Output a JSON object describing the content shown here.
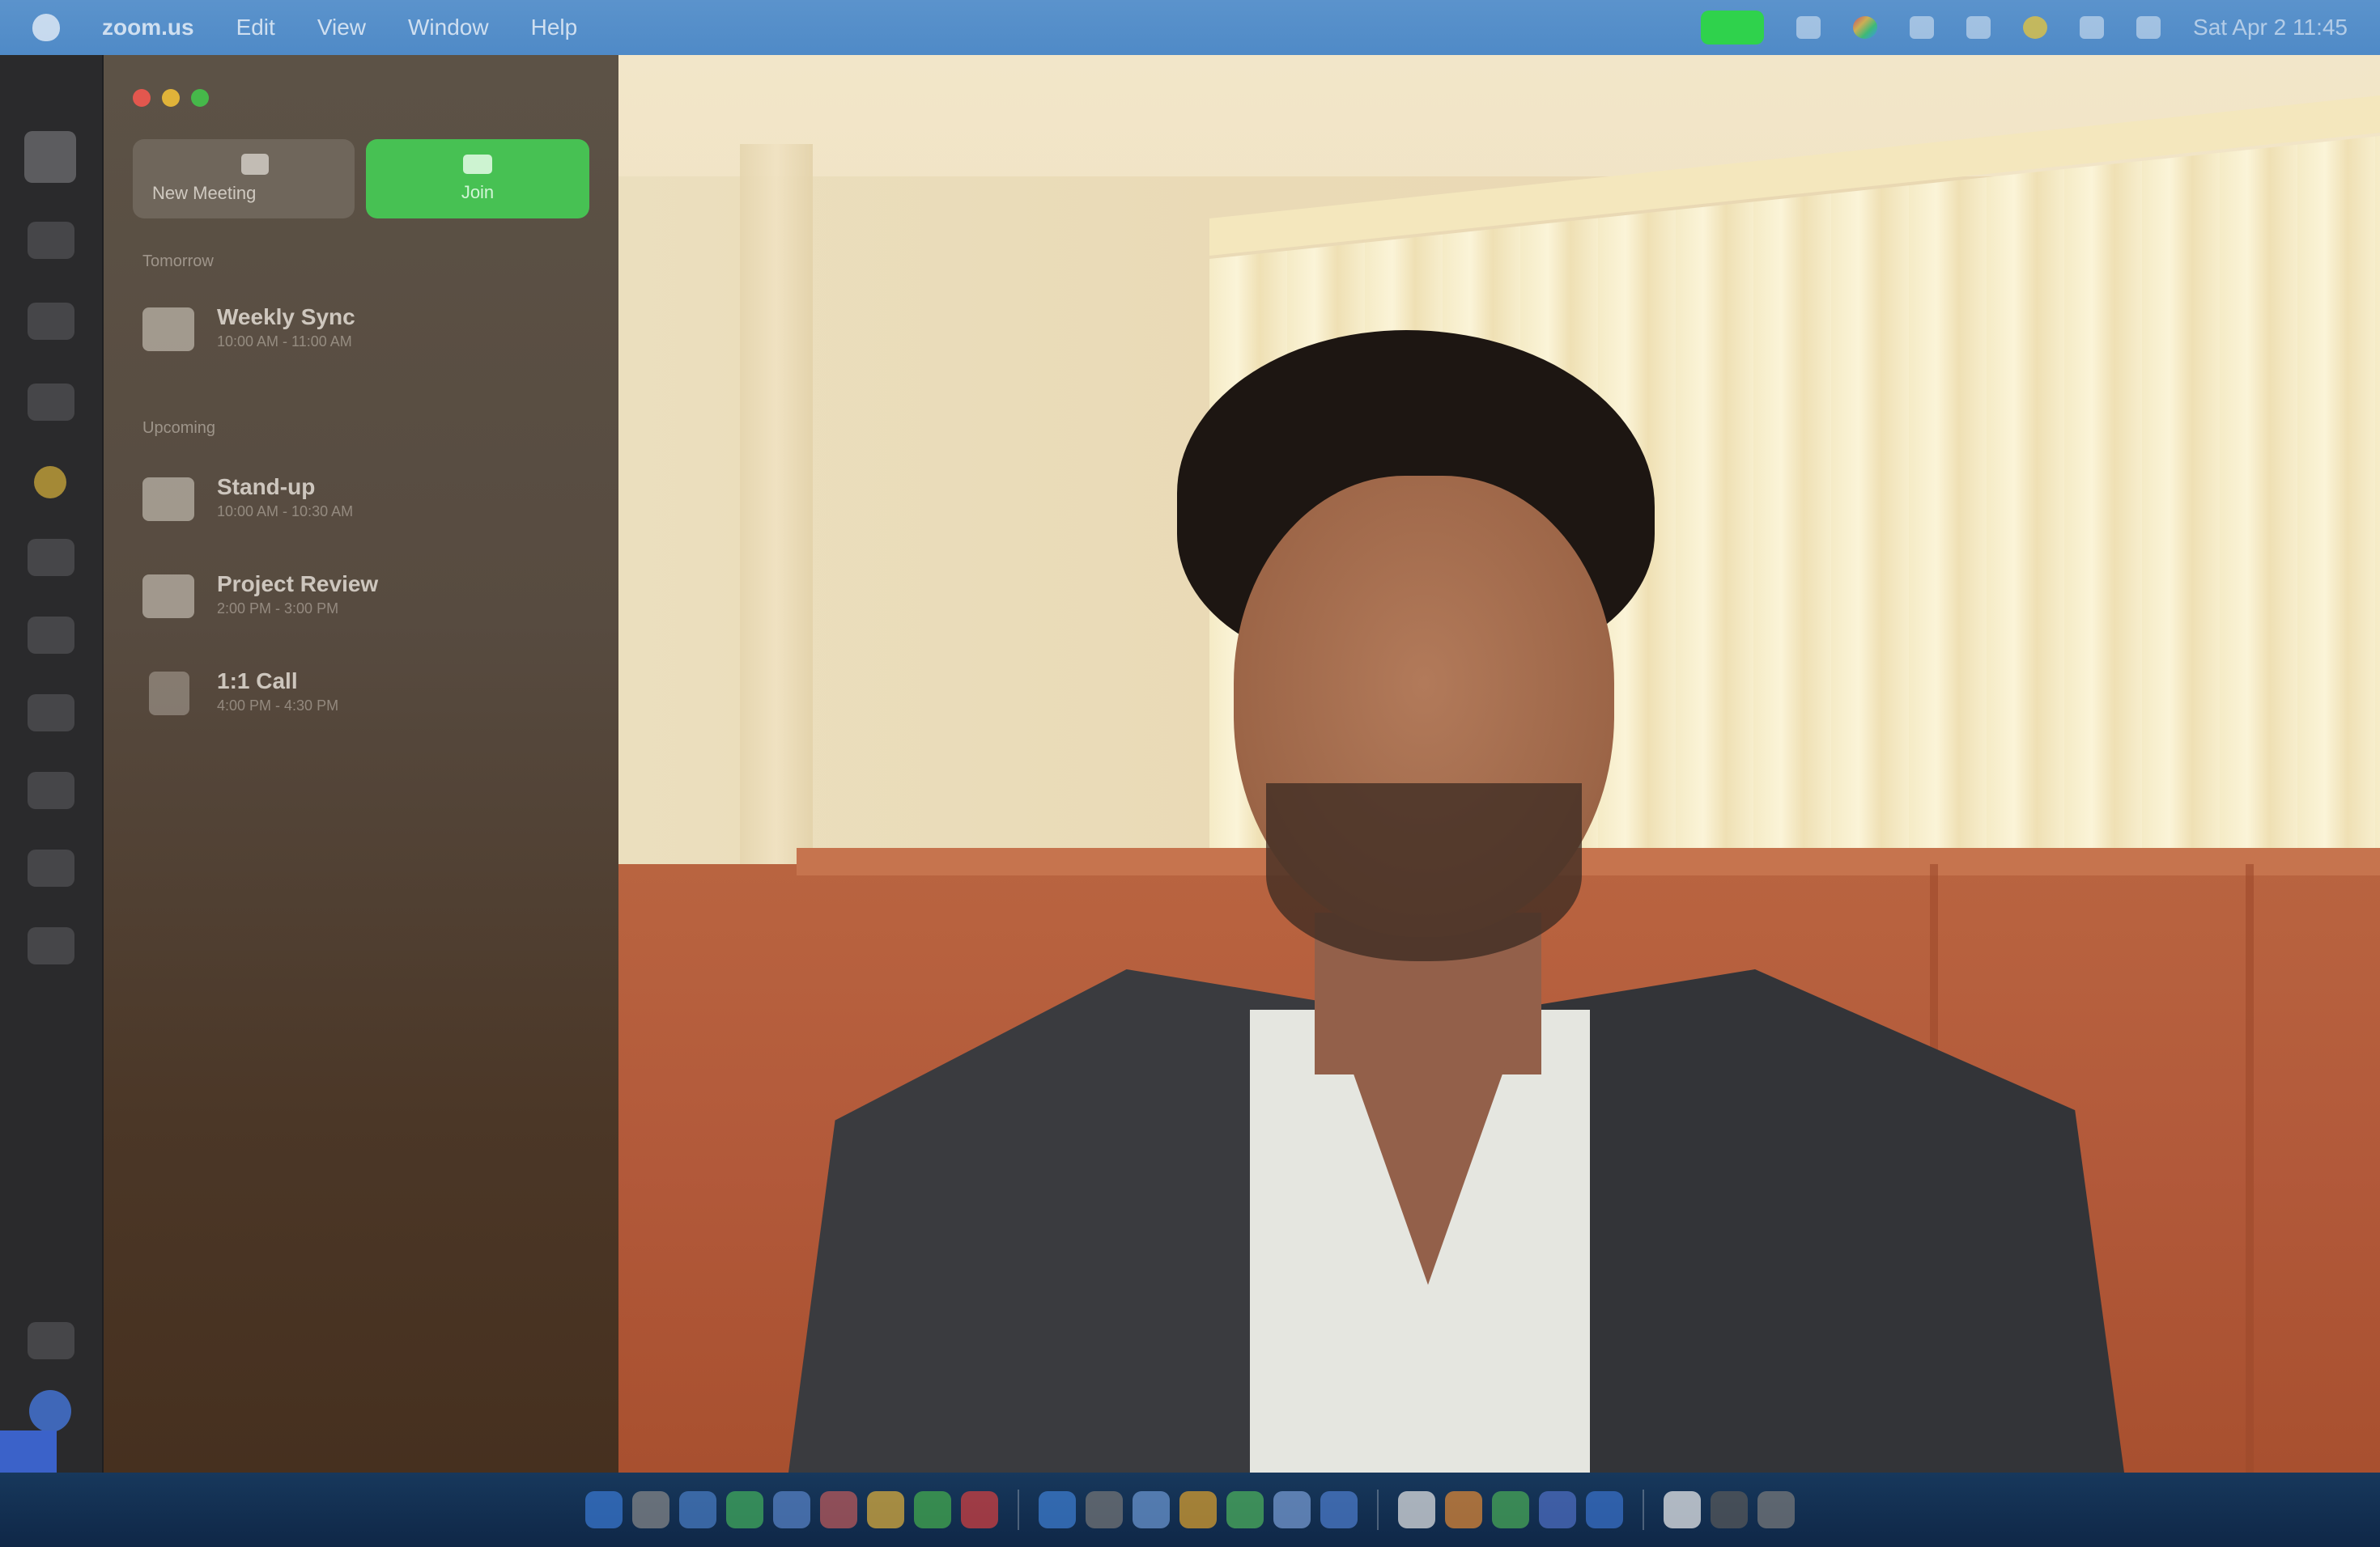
{
  "menubar": {
    "app_name": "zoom.us",
    "items": [
      "Edit",
      "View",
      "Window",
      "Help"
    ],
    "clock": "Sat Apr 2  11:45"
  },
  "zoom_home": {
    "new_meeting_label": "New Meeting",
    "join_label": "Join",
    "sections": [
      {
        "label": "Tomorrow",
        "meetings": [
          {
            "title": "Weekly Sync",
            "subtitle": "10:00 AM - 11:00 AM"
          }
        ]
      },
      {
        "label": "Upcoming",
        "meetings": [
          {
            "title": "Stand-up",
            "subtitle": "10:00 AM - 10:30 AM"
          },
          {
            "title": "Project Review",
            "subtitle": "2:00 PM - 3:00 PM"
          },
          {
            "title": "1:1 Call",
            "subtitle": "4:00 PM - 4:30 PM"
          }
        ]
      }
    ]
  },
  "rail_icons": [
    "home-icon",
    "chat-icon",
    "meetings-icon",
    "contacts-icon",
    "star-icon",
    "apps-icon",
    "phone-icon",
    "whiteboard-icon",
    "notes-icon",
    "mail-icon",
    "more-icon",
    "settings-icon",
    "avatar-icon"
  ],
  "dock_colors": [
    "#3a7bd5",
    "#8a8a8a",
    "#4a7fc8",
    "#43b05c",
    "#5a86cc",
    "#c25b5b",
    "#e3b23c",
    "#46b14e",
    "#d84040",
    "#3f80d6",
    "#777777",
    "#6d9ad6",
    "#e0a32c",
    "#4fb55c",
    "#7aa0d8",
    "#4f7fd0",
    "#e8e8e8",
    "#e48a35",
    "#4aae57",
    "#5070c8",
    "#3a73cf",
    "#f2f2f2",
    "#5a5a5a",
    "#7c7c7c"
  ]
}
